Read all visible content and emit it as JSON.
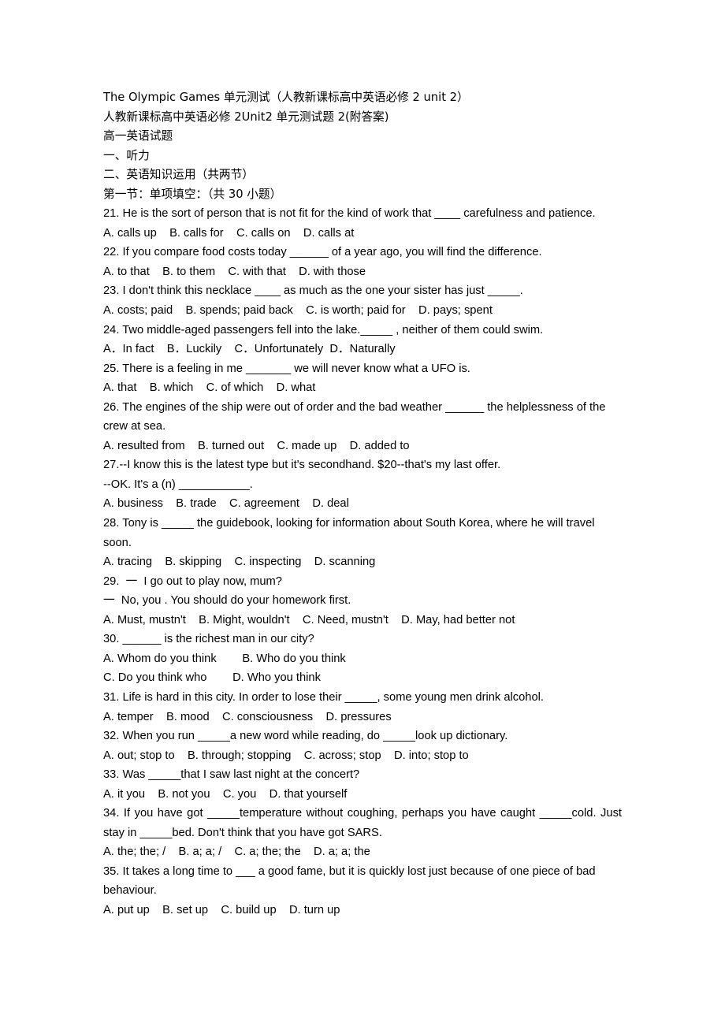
{
  "document": {
    "title_line": "The Olympic Games 单元测试（人教新课标高中英语必修 2 unit 2）",
    "subtitle_line": "人教新课标高中英语必修 2Unit2 单元测试题 2(附答案)",
    "paper_label": "高一英语试题",
    "section_listening": "一、听力",
    "section_knowledge": "二、英语知识运用（共两节）",
    "part_one": "第一节：单项填空：（共 30 小题）"
  },
  "questions": [
    {
      "number": "21",
      "stem": "21. He is the sort of person that is not fit for the kind of work that ____ carefulness and patience.",
      "options": "A. calls up    B. calls for    C. calls on    D. calls at",
      "justified": true
    },
    {
      "number": "22",
      "stem": "22. If you compare food costs today ______ of a year ago, you will find the difference.",
      "options": "A. to that    B. to them    C. with that    D. with those",
      "justified": false
    },
    {
      "number": "23",
      "stem": "23. I don't think this necklace ____ as much as the one your sister has just _____.",
      "options": "A. costs; paid    B. spends; paid back    C. is worth; paid for    D. pays; spent",
      "justified": false
    },
    {
      "number": "24",
      "stem": "24. Two middle-aged passengers fell into the lake._____ , neither of them could swim.",
      "options": "A．In fact    B．Luckily    C．Unfortunately  D．Naturally",
      "justified": false
    },
    {
      "number": "25",
      "stem": "25. There is a feeling in me _______ we will never know what a UFO is.",
      "options": "A. that    B. which    C. of which    D. what",
      "justified": false
    },
    {
      "number": "26",
      "stem": "26. The engines of the ship were out of order and the bad weather ______ the helplessness of the crew at sea.",
      "options": "A. resulted from    B. turned out    C. made up    D. added to",
      "justified": false
    },
    {
      "number": "27",
      "stem": "27.--I know this is the latest type but it's secondhand. $20--that's my last offer.",
      "stem_line2": "--OK. It's a (n) ___________.",
      "options": "A. business    B. trade    C. agreement    D. deal",
      "justified": false
    },
    {
      "number": "28",
      "stem": "28. Tony is _____ the guidebook, looking for information about South Korea, where he will travel soon.",
      "options": "A. tracing    B. skipping    C. inspecting    D. scanning",
      "justified": false
    },
    {
      "number": "29",
      "stem": "29.  一  I go out to play now, mum?",
      "stem_line2": "一  No, you . You should do your homework first.",
      "options": "A. Must, mustn't    B. Might, wouldn't    C. Need, mustn't    D. May, had better not",
      "justified": false
    },
    {
      "number": "30",
      "stem": "30. ______ is the richest man in our city?",
      "options": "A. Whom do you think        B. Who do you think",
      "options2": "C. Do you think who        D. Who you think",
      "justified": false
    },
    {
      "number": "31",
      "stem": "31. Life is hard in this city. In order to lose their _____, some young men drink alcohol.",
      "options": "A. temper    B. mood    C. consciousness    D. pressures",
      "justified": false
    },
    {
      "number": "32",
      "stem": "32. When you run _____a new word while reading, do _____look up dictionary.",
      "options": "A. out; stop to    B. through; stopping    C. across; stop    D. into; stop to",
      "justified": false
    },
    {
      "number": "33",
      "stem": "33. Was _____that I saw last night at the concert?",
      "options": "A. it you    B. not you    C. you    D. that yourself",
      "justified": false
    },
    {
      "number": "34",
      "stem": "34. If you have got _____temperature without coughing, perhaps you have caught _____cold. Just stay in _____bed. Don't think that you have got SARS.",
      "options": "A. the; the; /    B. a; a; /    C. a; the; the    D. a; a; the",
      "justified": true
    },
    {
      "number": "35",
      "stem": "35. It takes a long time to ___ a good fame, but it is quickly lost just because of one piece of bad behaviour.",
      "options": "A. put up    B. set up    C. build up    D. turn up",
      "justified": false
    }
  ]
}
